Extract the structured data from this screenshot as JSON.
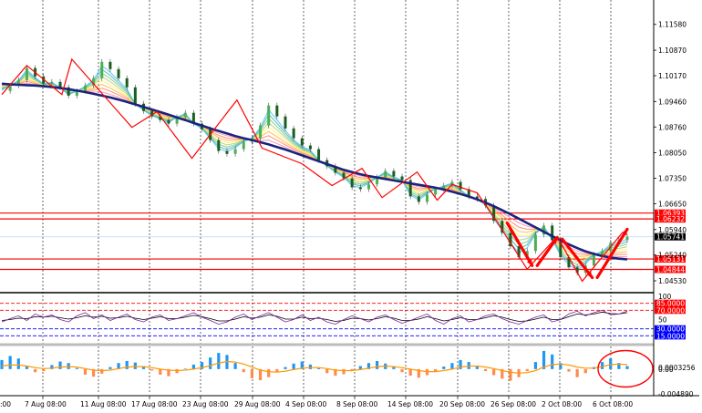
{
  "chart_data": {
    "type": "line",
    "title": "",
    "price_panel": {
      "ylim": [
        1.0423,
        1.1215
      ],
      "y_ticks": [
        "1.11580",
        "1.10870",
        "1.10170",
        "1.09460",
        "1.08760",
        "1.08050",
        "1.07350",
        "1.06650",
        "1.05940",
        "1.05240",
        "1.04530"
      ],
      "y_tick_values": [
        1.1158,
        1.1087,
        1.1017,
        1.0946,
        1.0876,
        1.0805,
        1.0735,
        1.0665,
        1.0594,
        1.0524,
        1.0453
      ],
      "current_price": {
        "label": "1.05741",
        "value": 1.05741
      },
      "horizontal_levels": [
        {
          "label": "1.06393",
          "value": 1.06393
        },
        {
          "label": "1.06232",
          "value": 1.06232
        },
        {
          "label": "1.05131",
          "value": 1.05131
        },
        {
          "label": "1.04844",
          "value": 1.04844
        }
      ],
      "price_line": [
        1.0975,
        1.099,
        1.1005,
        1.1038,
        1.1015,
        1.0995,
        1.1,
        1.0985,
        1.0962,
        1.0975,
        1.099,
        1.101,
        1.1055,
        1.1035,
        1.101,
        1.0985,
        1.094,
        1.092,
        1.0905,
        1.0895,
        1.0885,
        1.0903,
        1.0915,
        1.0885,
        1.087,
        1.084,
        1.081,
        1.0802,
        1.0815,
        1.0835,
        1.0845,
        1.088,
        1.0935,
        1.0905,
        1.0872,
        1.0845,
        1.0825,
        1.0815,
        1.0785,
        1.0768,
        1.075,
        1.0735,
        1.071,
        1.0705,
        1.0718,
        1.0738,
        1.0755,
        1.074,
        1.073,
        1.0685,
        1.067,
        1.069,
        1.0705,
        1.0715,
        1.0725,
        1.0705,
        1.0685,
        1.0678,
        1.066,
        1.0618,
        1.0585,
        1.0548,
        1.0518,
        1.0535,
        1.058,
        1.0605,
        1.0565,
        1.0518,
        1.049,
        1.0475,
        1.0495,
        1.0525,
        1.0535,
        1.0558,
        1.0565,
        1.0574
      ],
      "moving_average": [
        1.0995,
        1.0993,
        1.0992,
        1.0991,
        1.099,
        1.0988,
        1.0986,
        1.0983,
        1.098,
        1.0976,
        1.0972,
        1.0967,
        1.0962,
        1.0957,
        1.0951,
        1.0945,
        1.0938,
        1.0931,
        1.0924,
        1.0917,
        1.091,
        1.0902,
        1.0895,
        1.0887,
        1.088,
        1.0872,
        1.0865,
        1.0858,
        1.0851,
        1.0845,
        1.084,
        1.0834,
        1.0828,
        1.0821,
        1.0814,
        1.0806,
        1.0798,
        1.079,
        1.0782,
        1.0774,
        1.0766,
        1.0758,
        1.0752,
        1.0746,
        1.0741,
        1.0737,
        1.0733,
        1.0729,
        1.0725,
        1.0721,
        1.0717,
        1.0713,
        1.0709,
        1.0704,
        1.0698,
        1.0692,
        1.0685,
        1.0677,
        1.0668,
        1.0658,
        1.0647,
        1.0636,
        1.0624,
        1.0612,
        1.06,
        1.0588,
        1.0576,
        1.0564,
        1.0553,
        1.0543,
        1.0534,
        1.0527,
        1.0521,
        1.0517,
        1.0514,
        1.0512
      ],
      "zigzag": [
        [
          0,
          1.0965
        ],
        [
          5,
          1.1045
        ],
        [
          12,
          1.0965
        ],
        [
          14,
          1.1062
        ],
        [
          26,
          1.0875
        ],
        [
          31,
          1.0918
        ],
        [
          38,
          1.079
        ],
        [
          47,
          1.095
        ],
        [
          52,
          1.0818
        ],
        [
          60,
          1.0775
        ],
        [
          66,
          1.0715
        ],
        [
          72,
          1.0762
        ],
        [
          76,
          1.0682
        ],
        [
          83,
          1.0752
        ],
        [
          87,
          1.0675
        ],
        [
          90,
          1.0718
        ],
        [
          95,
          1.0695
        ],
        [
          99,
          1.0615
        ],
        [
          105,
          1.0485
        ],
        [
          111,
          1.0575
        ],
        [
          116,
          1.0452
        ],
        [
          124,
          1.0585
        ]
      ],
      "arrows": [
        [
          [
            101,
            1.0612
          ],
          [
            106,
            1.0495
          ]
        ],
        [
          [
            107,
            1.0495
          ],
          [
            111,
            1.0572
          ]
        ],
        [
          [
            112,
            1.0568
          ],
          [
            118,
            1.0462
          ]
        ],
        [
          [
            119,
            1.0462
          ],
          [
            125,
            1.0595
          ]
        ]
      ]
    },
    "rsi_panel": {
      "ylim": [
        0,
        100
      ],
      "levels": [
        {
          "label": "85.0000",
          "value": 85
        },
        {
          "label": "70.0000",
          "value": 70
        },
        {
          "label": "30.0000",
          "value": 30
        },
        {
          "label": "15.0000",
          "value": 15
        }
      ],
      "y_ticks": [
        "100",
        "50"
      ],
      "y_tick_values": [
        100,
        50
      ],
      "series_fast": [
        45,
        52,
        58,
        48,
        62,
        55,
        60,
        50,
        45,
        58,
        65,
        52,
        60,
        48,
        55,
        62,
        50,
        45,
        55,
        60,
        48,
        52,
        58,
        65,
        55,
        48,
        40,
        45,
        55,
        62,
        50,
        58,
        65,
        55,
        45,
        50,
        60,
        48,
        55,
        45,
        40,
        50,
        58,
        52,
        45,
        55,
        60,
        50,
        42,
        48,
        55,
        62,
        48,
        40,
        52,
        58,
        45,
        50,
        58,
        62,
        52,
        45,
        40,
        48,
        55,
        60,
        45,
        50,
        62,
        68,
        58,
        65,
        70,
        60,
        62,
        68
      ],
      "series_slow": [
        48,
        50,
        53,
        52,
        56,
        55,
        57,
        54,
        51,
        54,
        58,
        55,
        57,
        53,
        54,
        57,
        53,
        50,
        53,
        56,
        52,
        52,
        55,
        59,
        56,
        52,
        47,
        47,
        51,
        56,
        53,
        55,
        60,
        57,
        51,
        51,
        55,
        52,
        53,
        50,
        46,
        48,
        53,
        52,
        49,
        52,
        56,
        53,
        48,
        48,
        51,
        56,
        52,
        47,
        50,
        54,
        50,
        50,
        54,
        58,
        55,
        50,
        46,
        47,
        51,
        55,
        50,
        50,
        56,
        62,
        60,
        62,
        66,
        63,
        62,
        65
      ]
    },
    "macd_panel": {
      "ylim": [
        -0.0048903,
        0.0043
      ],
      "y_ticks": [
        "0.0003256",
        "0.00",
        "-0.004890"
      ],
      "y_tick_values": [
        0.0003256,
        0.0,
        -0.00489
      ],
      "histogram": [
        0.0018,
        0.0026,
        0.0021,
        0.0005,
        -0.0006,
        -0.0004,
        0.0008,
        0.0015,
        0.0012,
        0.0002,
        -0.0011,
        -0.0015,
        -0.0009,
        0.0004,
        0.0012,
        0.0016,
        0.0013,
        0.0006,
        -0.0003,
        -0.0011,
        -0.0014,
        -0.0008,
        0.0001,
        0.0009,
        0.0014,
        0.0023,
        0.0032,
        0.0028,
        0.0012,
        -0.0006,
        -0.0018,
        -0.0022,
        -0.0016,
        -0.0005,
        0.0004,
        0.0011,
        0.0015,
        0.0009,
        0.0002,
        -0.0008,
        -0.0013,
        -0.001,
        -0.0003,
        0.0006,
        0.0012,
        0.0016,
        0.0011,
        0.0004,
        -0.0006,
        -0.0013,
        -0.0017,
        -0.0012,
        -0.0004,
        0.0005,
        0.0012,
        0.0018,
        0.0014,
        0.0005,
        -0.0004,
        -0.0012,
        -0.0019,
        -0.0023,
        -0.0016,
        -0.0004,
        0.0014,
        0.0036,
        0.0029,
        0.0012,
        -0.0005,
        -0.0016,
        -0.0008,
        0.0004,
        0.0014,
        0.0021,
        0.0012,
        0.0006
      ],
      "signal": [
        0.0006,
        0.0008,
        0.0008,
        0.0006,
        0.0003,
        0.0001,
        0.0002,
        0.0004,
        0.0005,
        0.0004,
        0.0001,
        -0.0002,
        -0.0003,
        -0.0002,
        0.0001,
        0.0004,
        0.0005,
        0.0005,
        0.0003,
        0.0,
        -0.0002,
        -0.0003,
        -0.0002,
        0.0,
        0.0003,
        0.0007,
        0.0012,
        0.0015,
        0.0014,
        0.001,
        0.0004,
        -0.0002,
        -0.0005,
        -0.0006,
        -0.0004,
        -0.0001,
        0.0002,
        0.0003,
        0.0003,
        0.0001,
        -0.0002,
        -0.0003,
        -0.0003,
        -0.0001,
        0.0002,
        0.0005,
        0.0006,
        0.0005,
        0.0003,
        0.0,
        -0.0003,
        -0.0005,
        -0.0005,
        -0.0003,
        0.0,
        0.0004,
        0.0006,
        0.0006,
        0.0004,
        0.0001,
        -0.0003,
        -0.0006,
        -0.0008,
        -0.0007,
        -0.0003,
        0.0004,
        0.0009,
        0.001,
        0.0008,
        0.0004,
        0.0002,
        0.0002,
        0.0005,
        0.0009,
        0.001,
        0.0009
      ]
    },
    "x_labels": [
      "7 Aug 08:00",
      "11 Aug 08:00",
      "17 Aug 08:00",
      "23 Aug 08:00",
      "29 Aug 08:00",
      "4 Sep 08:00",
      "8 Sep 08:00",
      "14 Sep 08:00",
      "20 Sep 08:00",
      "26 Sep 08:00",
      "2 Oct 08:00",
      "6 Oct 08:00"
    ],
    "x_label_partial_left": ":00",
    "annotation": {
      "type": "circle",
      "panel": "macd",
      "near_label": "6 Oct 08:00"
    },
    "colors": {
      "price": "#2e7d32",
      "moving_average": "#1a237e",
      "zigzag": "#ff0000",
      "levels": "#ff0000",
      "rsi_fast": "#7b1fa2",
      "rsi_slow": "#000000",
      "rsi_high": "#ff0000",
      "rsi_low": "#0000ff",
      "macd_pos": "#2196f3",
      "macd_neg": "#ff8a50",
      "macd_signal": "#ff9800",
      "current_price_bg": "#000000",
      "level_label_bg": "#ff0000"
    }
  }
}
